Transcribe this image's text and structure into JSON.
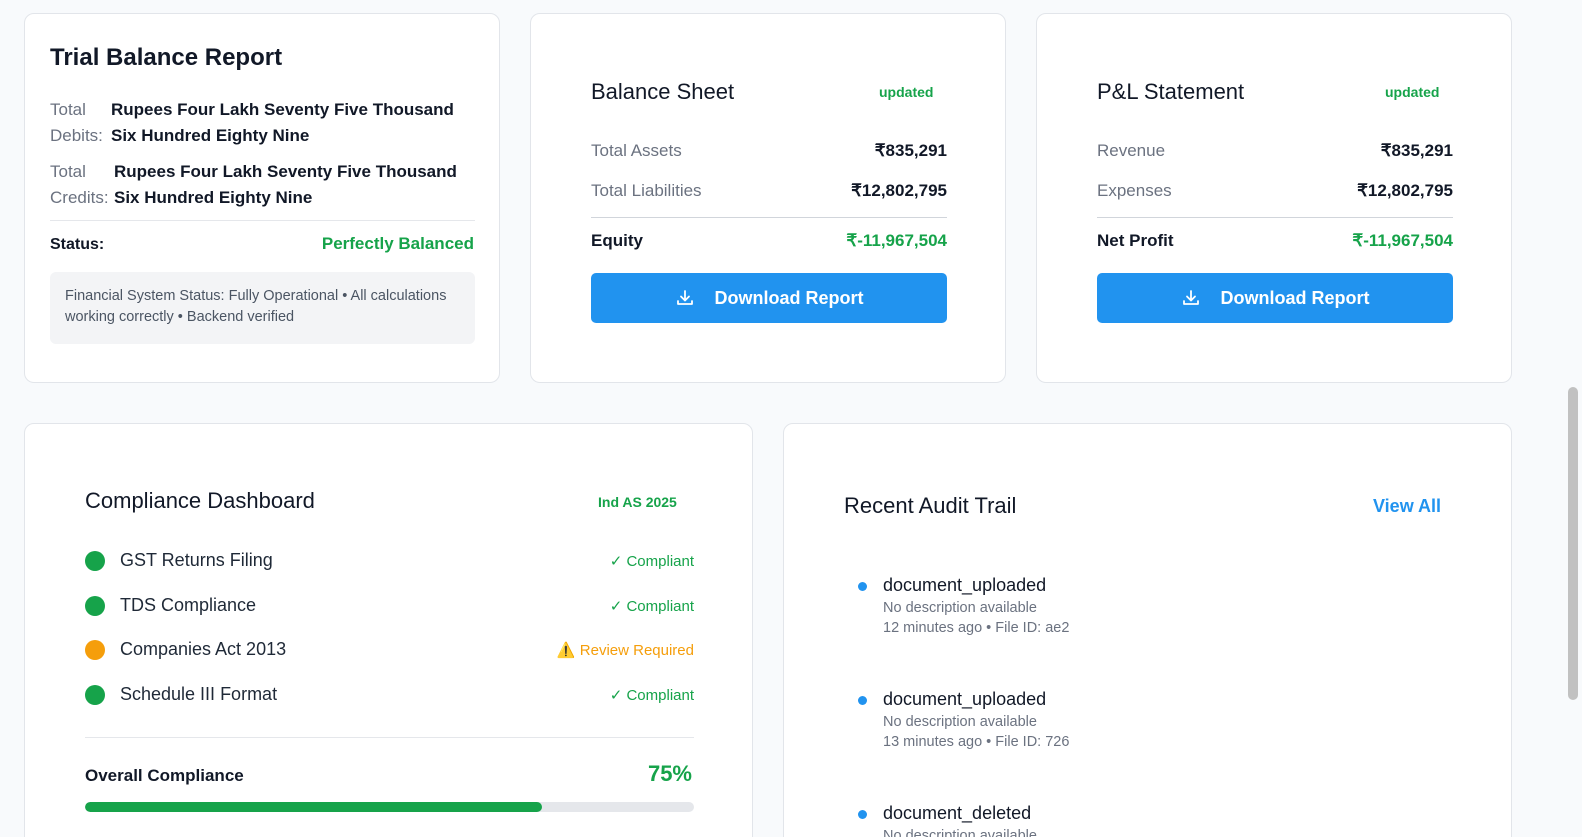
{
  "trial_balance": {
    "title": "Trial Balance Report",
    "debits_label": "Total Debits:",
    "debits_value": "Rupees Four Lakh Seventy Five Thousand Six Hundred Eighty Nine",
    "credits_label": "Total Credits:",
    "credits_value": "Rupees Four Lakh Seventy Five Thousand Six Hundred Eighty Nine",
    "status_label": "Status:",
    "status_value": "Perfectly Balanced",
    "note": "Financial System Status: Fully Operational • All calculations working correctly • Backend verified",
    "colors": {
      "status": "#16a34a"
    }
  },
  "balance_sheet": {
    "title": "Balance Sheet",
    "badge": "updated",
    "rows": [
      {
        "label": "Total Assets",
        "value": "₹835,291"
      },
      {
        "label": "Total Liabilities",
        "value": "₹12,802,795"
      },
      {
        "label": "Equity",
        "value": "₹-11,967,504"
      }
    ],
    "download_label": "Download Report",
    "download_icon": "download-icon"
  },
  "pl_statement": {
    "title": "P&L Statement",
    "badge": "updated",
    "rows": [
      {
        "label": "Revenue",
        "value": "₹835,291"
      },
      {
        "label": "Expenses",
        "value": "₹12,802,795"
      },
      {
        "label": "Net Profit",
        "value": "₹-11,967,504"
      }
    ],
    "download_label": "Download Report",
    "download_icon": "download-icon"
  },
  "compliance": {
    "title": "Compliance Dashboard",
    "badge": "Ind AS 2025",
    "items": [
      {
        "name": "GST Returns Filing",
        "status": "✓ Compliant",
        "color": "#16a34a"
      },
      {
        "name": "TDS Compliance",
        "status": "✓ Compliant",
        "color": "#16a34a"
      },
      {
        "name": "Companies Act 2013",
        "status": "⚠️ Review Required",
        "color": "#f59e0b"
      },
      {
        "name": "Schedule III Format",
        "status": "✓ Compliant",
        "color": "#16a34a"
      }
    ],
    "overall_label": "Overall Compliance",
    "overall_value": "75%",
    "overall_fraction": 0.75
  },
  "audit_trail": {
    "title": "Recent Audit Trail",
    "view_all": "View All",
    "items": [
      {
        "event": "document_uploaded",
        "description": "No description available",
        "meta": "12 minutes ago • File ID: ae2"
      },
      {
        "event": "document_uploaded",
        "description": "No description available",
        "meta": "13 minutes ago • File ID: 726"
      },
      {
        "event": "document_deleted",
        "description": "No description available",
        "meta": ""
      }
    ]
  },
  "colors": {
    "accent": "#2193ef",
    "success": "#16a34a",
    "warning": "#f59e0b"
  }
}
